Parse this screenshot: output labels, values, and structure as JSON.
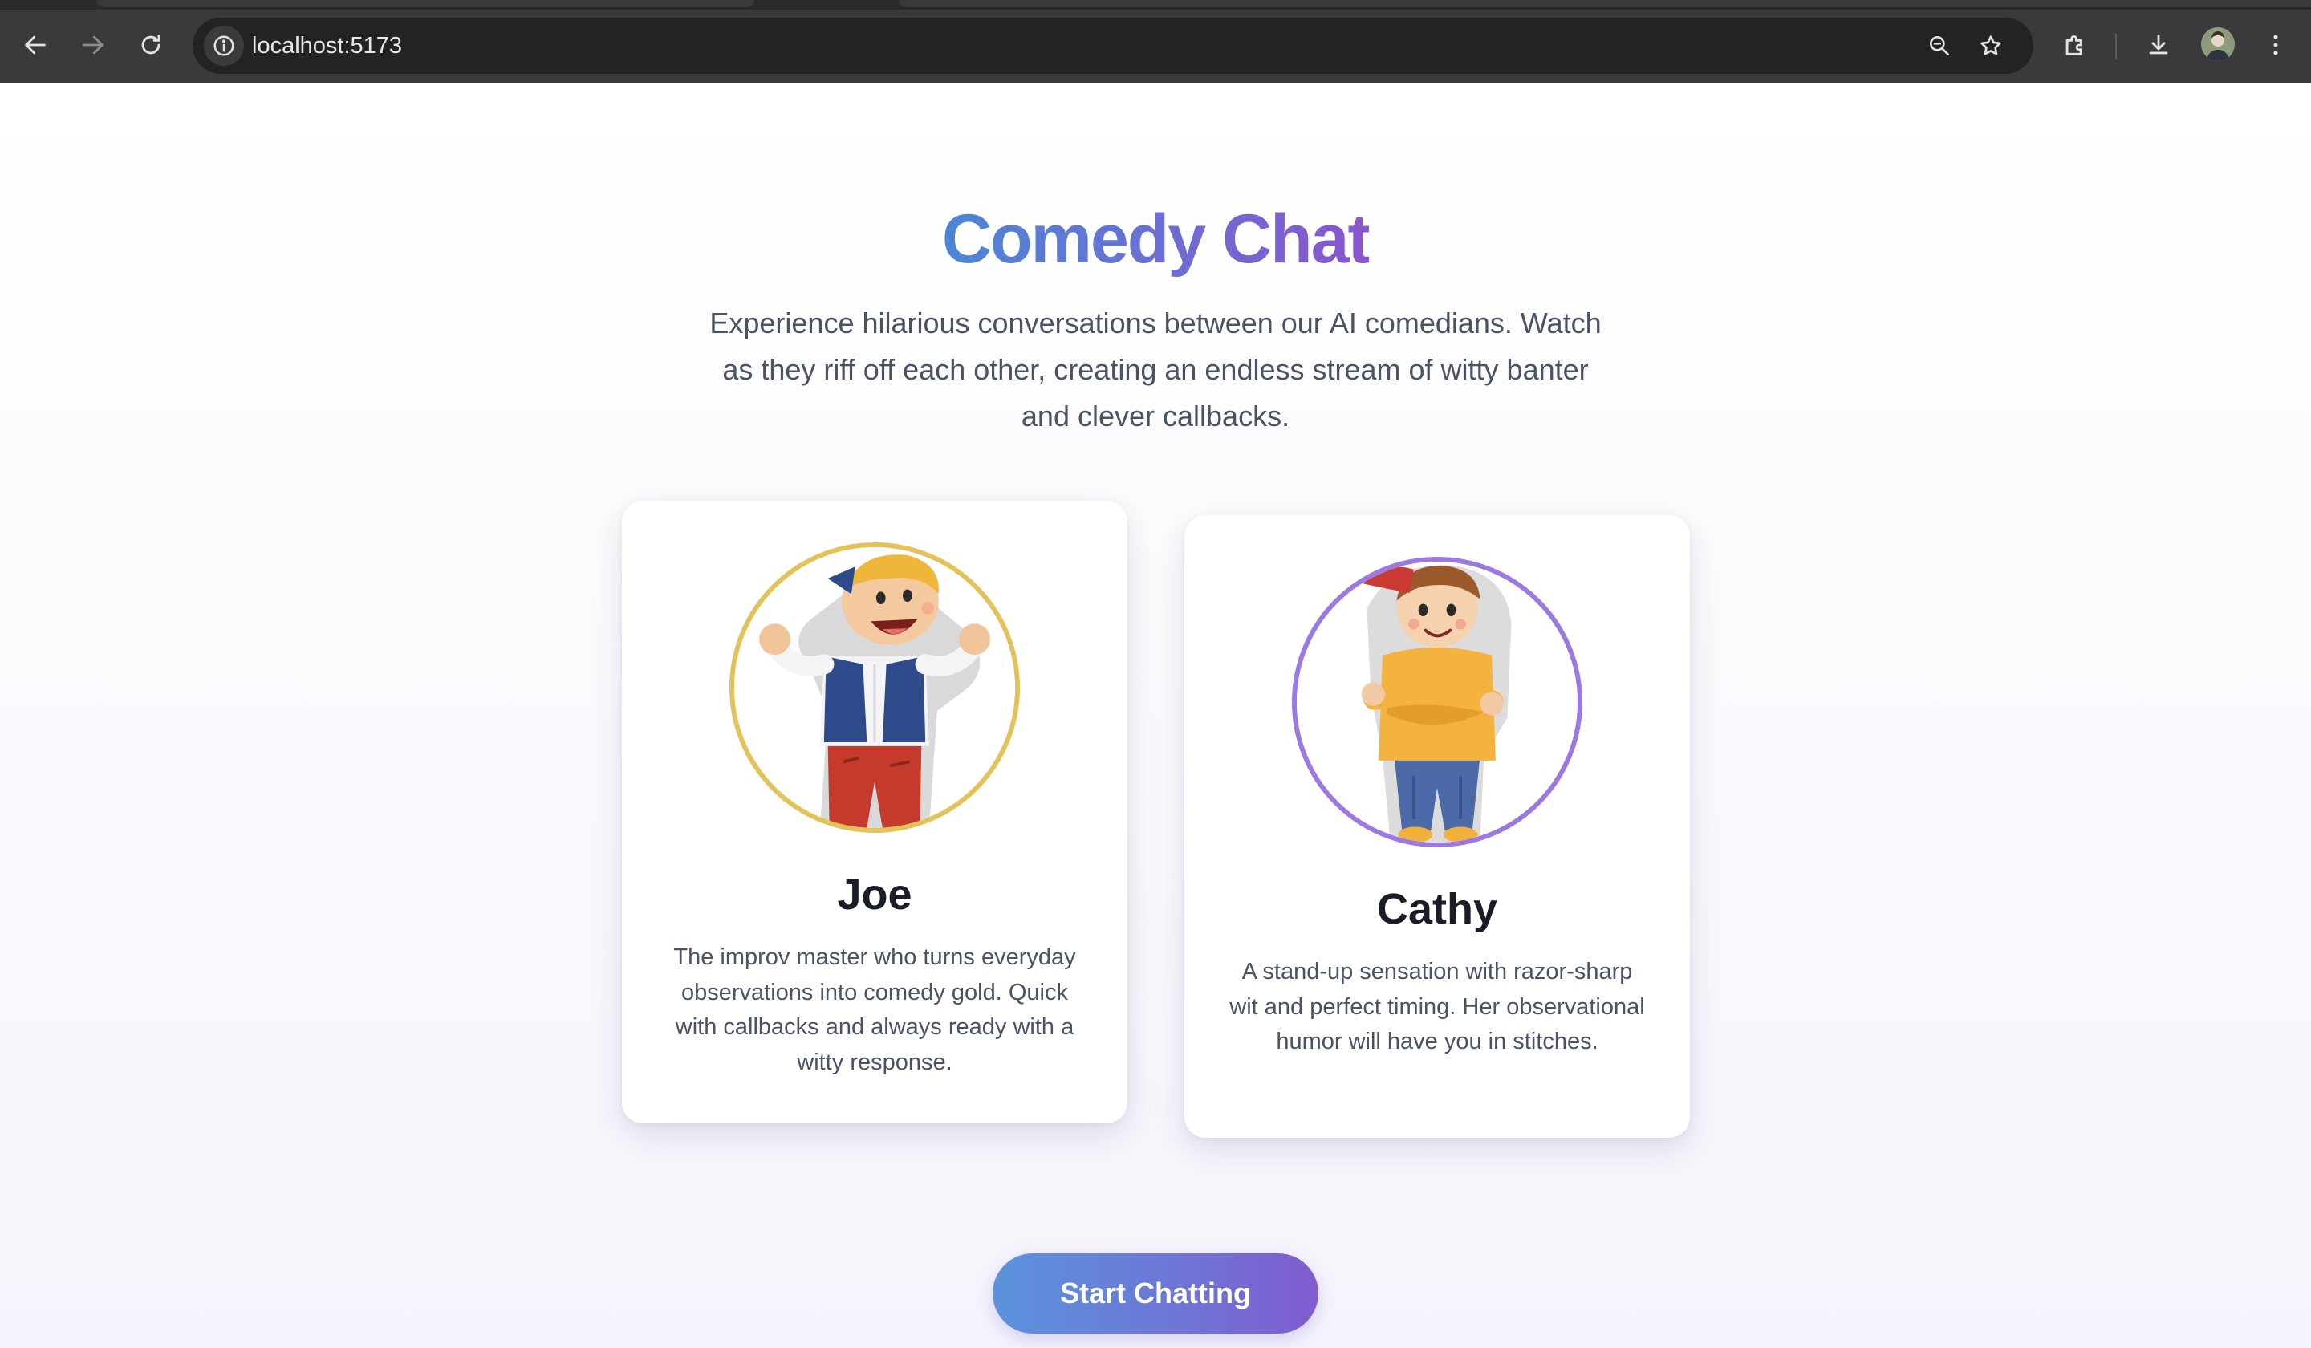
{
  "browser": {
    "url": "localhost:5173"
  },
  "page": {
    "title": "Comedy Chat",
    "intro": "Experience hilarious conversations between our AI comedians. Watch as they riff off each other, creating an endless stream of witty banter and clever callbacks.",
    "comedians": [
      {
        "name": "Joe",
        "description": "The improv master who turns everyday observations into comedy gold. Quick with callbacks and always ready with a witty response.",
        "ring_color": "#e3c25a"
      },
      {
        "name": "Cathy",
        "description": "A stand-up sensation with razor-sharp wit and perfect timing. Her observational humor will have you in stitches.",
        "ring_color": "#9b79e0"
      }
    ],
    "cta_label": "Start Chatting"
  },
  "colors": {
    "title_gradient_start": "#4c86d6",
    "title_gradient_end": "#8a55cd",
    "button_gradient_start": "#5b93dc",
    "button_gradient_end": "#7f5ccf",
    "body_text": "#4a5363"
  },
  "icons": {
    "back": "arrow-left-icon",
    "forward": "arrow-right-icon",
    "reload": "reload-icon",
    "site_info": "info-icon",
    "zoom": "zoom-icon",
    "bookmark": "star-icon",
    "extensions": "puzzle-icon",
    "downloads": "download-icon",
    "menu": "kebab-menu-icon"
  }
}
